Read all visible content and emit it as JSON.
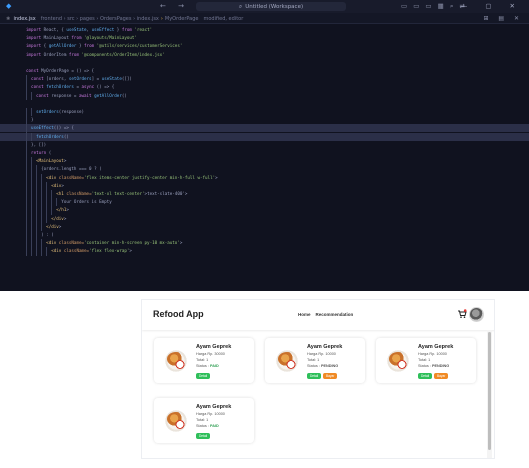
{
  "window": {
    "command_center": "Untitled (Workspace)",
    "nav_arrows": "← →",
    "layout_icons": "▭ ▭ ▭ ▦ ⌕ ⇄",
    "window_controls": "— ▢ ✕"
  },
  "tab": {
    "filename": "index.jsx",
    "path_breadcrumb": "frontend › src › pages › OrdersPages › index.jsx",
    "arrow": "›",
    "symbol": "MyOrderPage",
    "badge": "modified, editor"
  },
  "tab_actions": "⊞ ▤ ✕",
  "code_lines": [
    "import React, { useState, useEffect } from 'react'",
    "import MainLayout from '@layouts/MainLayout'",
    "import { getAllOrder } from '@utils/services/customerServices'",
    "import OrderItem from '@components/OrderItem/index.jsx'",
    "",
    "const MyOrderPage = () => {",
    "  const [orders, setOrders] = useState([])",
    "  const fetchOrders = async () => {",
    "    const response = await getAllOrder()",
    "",
    "    setOrders(response)",
    "  }",
    "  useEffect(() => {",
    "    fetchOrders()",
    "  }, [])",
    "  return (",
    "    <MainLayout>",
    "      {orders.length === 0 ? (",
    "        <div className='flex items-center justify-center min-h-full w-full'>",
    "          <div>",
    "            <h1 className='text-xl text-center'>text-slate-400'>",
    "              Your Orders is Empty",
    "            </h1>",
    "          </div>",
    "        </div>",
    "      ) : (",
    "        <div className='container min-h-screen py-10 mx-auto'>",
    "          <div className='flex flex-wrap'>"
  ],
  "app": {
    "brand": "Refood App",
    "nav": [
      "Home",
      "Recommendation"
    ],
    "cart_icon": "cart-icon",
    "avatar_icon": "avatar"
  },
  "orders": [
    {
      "name": "Ayam Geprek",
      "price": "Harga Rp. 30000",
      "total": "Total: 1",
      "status_label": "Status :",
      "status": "PAID",
      "buttons": [
        "Detail"
      ]
    },
    {
      "name": "Ayam Geprek",
      "price": "Harga Rp. 10000",
      "total": "Total: 1",
      "status_label": "Status :",
      "status": "PENDING",
      "buttons": [
        "Detail",
        "Bayar"
      ]
    },
    {
      "name": "Ayam Geprek",
      "price": "Harga Rp. 10000",
      "total": "Total: 1",
      "status_label": "Status :",
      "status": "PENDING",
      "buttons": [
        "Detail",
        "Bayar"
      ]
    },
    {
      "name": "Ayam Geprek",
      "price": "Harga Rp. 10000",
      "total": "Total: 1",
      "status_label": "Status :",
      "status": "PAID",
      "buttons": [
        "Detail"
      ]
    }
  ],
  "colors": {
    "editor_bg": "#10121f",
    "paid": "#2e9e52",
    "detail_button": "#2fbf5a",
    "bayar_button": "#f08a24"
  }
}
